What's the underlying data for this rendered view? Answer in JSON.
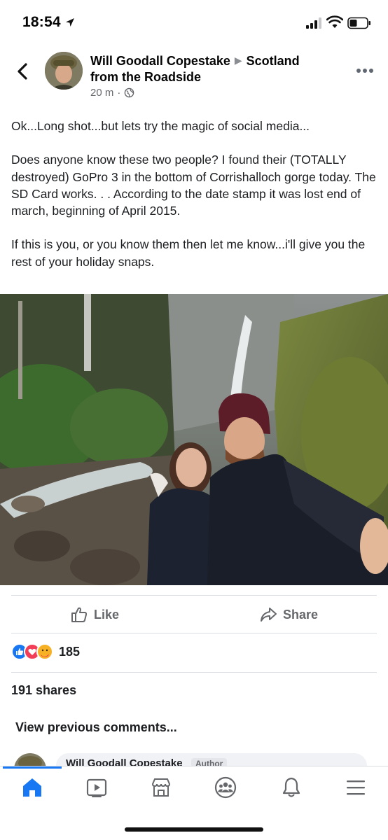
{
  "status_bar": {
    "time": "18:54"
  },
  "post": {
    "author": "Will Goodall Copestake",
    "group": "Scotland from the Roadside",
    "time_ago": "20 m",
    "meta_separator": "·",
    "paragraphs": [
      "Ok...Long shot...but lets try the magic of social media...",
      "Does anyone know these two people? I found their (TOTALLY destroyed) GoPro 3 in the bottom of Corrishalloch gorge today. The SD Card works. . . According to the date stamp it was lost end of march, beginning of April 2015.",
      "If this is you, or you know them then let me know...i'll give you the rest of your holiday snaps."
    ]
  },
  "actions": {
    "like_label": "Like",
    "share_label": "Share"
  },
  "stats": {
    "reaction_count": "185",
    "shares_label": "191 shares"
  },
  "comments": {
    "view_previous": "View previous comments...",
    "first_comment_author": "Will Goodall Copestake",
    "author_badge": "Author"
  },
  "icons": {
    "back": "chevron-left-icon",
    "more": "more-dots-icon",
    "globe": "globe-icon",
    "like": "thumbs-up-icon",
    "share": "share-arrow-icon",
    "tabs": [
      "home-icon",
      "video-icon",
      "marketplace-icon",
      "groups-icon",
      "bell-icon",
      "menu-icon"
    ]
  },
  "colors": {
    "accent": "#1877f2",
    "love": "#f33e58",
    "care": "#f7b125",
    "text_secondary": "#65676b"
  }
}
